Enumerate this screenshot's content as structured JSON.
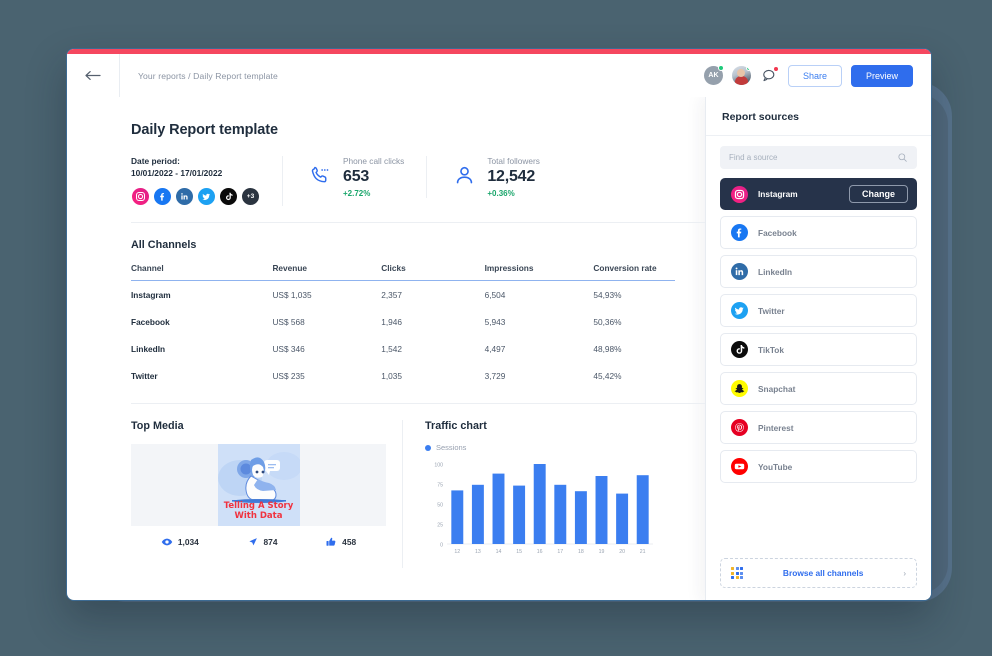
{
  "window": {
    "accent_color": "#f5475f",
    "background_color": "#4a6370"
  },
  "header": {
    "back_icon": "arrow-left-icon",
    "breadcrumb": "Your reports / Daily Report template",
    "avatars": [
      {
        "name": "avatar-initials",
        "initials": "AK",
        "online": true
      },
      {
        "name": "avatar-photo",
        "initials": "",
        "online": true
      }
    ],
    "chat_icon": "chat-bubble-icon",
    "share_label": "Share",
    "preview_label": "Preview"
  },
  "main": {
    "page_title": "Daily Report template",
    "date": {
      "label": "Date period:",
      "value": "10/01/2022 - 17/01/2022",
      "channels": [
        {
          "name": "instagram",
          "glyph": "◎"
        },
        {
          "name": "facebook",
          "glyph": "f"
        },
        {
          "name": "linkedin",
          "glyph": "in"
        },
        {
          "name": "twitter",
          "glyph": "ᴠ"
        },
        {
          "name": "tiktok",
          "glyph": "♪"
        }
      ],
      "more_badge": "+3"
    },
    "kpis": [
      {
        "icon": "phone-call-icon",
        "label": "Phone call clicks",
        "value": "653",
        "delta": "+2.72%"
      },
      {
        "icon": "user-icon",
        "label": "Total followers",
        "value": "12,542",
        "delta": "+0.36%"
      }
    ],
    "channels_section": {
      "title": "All Channels",
      "columns": [
        "Channel",
        "Revenue",
        "Clicks",
        "Impressions",
        "Conversion rate"
      ],
      "rows": [
        {
          "channel": "Instagram",
          "revenue": "US$ 1,035",
          "clicks": "2,357",
          "impressions": "6,504",
          "conversion": "54,93%"
        },
        {
          "channel": "Facebook",
          "revenue": "US$ 568",
          "clicks": "1,946",
          "impressions": "5,943",
          "conversion": "50,36%"
        },
        {
          "channel": "LinkedIn",
          "revenue": "US$ 346",
          "clicks": "1,542",
          "impressions": "4,497",
          "conversion": "48,98%"
        },
        {
          "channel": "Twitter",
          "revenue": "US$ 235",
          "clicks": "1,035",
          "impressions": "3,729",
          "conversion": "45,42%"
        }
      ]
    },
    "top_media": {
      "title": "Top Media",
      "image_caption_line1": "Telling A Story",
      "image_caption_line2": "With Data",
      "stats": [
        {
          "icon": "eye-icon",
          "value": "1,034"
        },
        {
          "icon": "share-arrow-icon",
          "value": "874"
        },
        {
          "icon": "thumbs-up-icon",
          "value": "458"
        }
      ]
    },
    "traffic": {
      "title": "Traffic chart"
    }
  },
  "chart_data": {
    "type": "bar",
    "title": "Traffic chart",
    "categories": [
      "12",
      "13",
      "14",
      "15",
      "16",
      "17",
      "18",
      "19",
      "20",
      "21"
    ],
    "series": [
      {
        "name": "Sessions",
        "color": "#3b7ef0",
        "values": [
          67,
          74,
          88,
          73,
          100,
          74,
          66,
          85,
          63,
          86
        ]
      }
    ],
    "legend": [
      "Sessions"
    ],
    "legend_position": "top-left",
    "xlabel": "",
    "ylabel": "",
    "ylim": [
      0,
      100
    ],
    "yticks": [
      0,
      25,
      50,
      75,
      100
    ],
    "grid": false
  },
  "sidebar": {
    "title": "Report sources",
    "search_placeholder": "Find a source",
    "search_icon": "search-icon",
    "sources": [
      {
        "name": "instagram",
        "label": "Instagram",
        "selected": true,
        "action_label": "Change"
      },
      {
        "name": "facebook",
        "label": "Facebook",
        "selected": false
      },
      {
        "name": "linkedin",
        "label": "LinkedIn",
        "selected": false
      },
      {
        "name": "twitter",
        "label": "Twitter",
        "selected": false
      },
      {
        "name": "tiktok",
        "label": "TikTok",
        "selected": false
      },
      {
        "name": "snapchat",
        "label": "Snapchat",
        "selected": false
      },
      {
        "name": "pinterest",
        "label": "Pinterest",
        "selected": false
      },
      {
        "name": "youtube",
        "label": "YouTube",
        "selected": false
      }
    ],
    "browse_all_label": "Browse all channels",
    "browse_icon": "grid-icon",
    "chevron": "›"
  }
}
